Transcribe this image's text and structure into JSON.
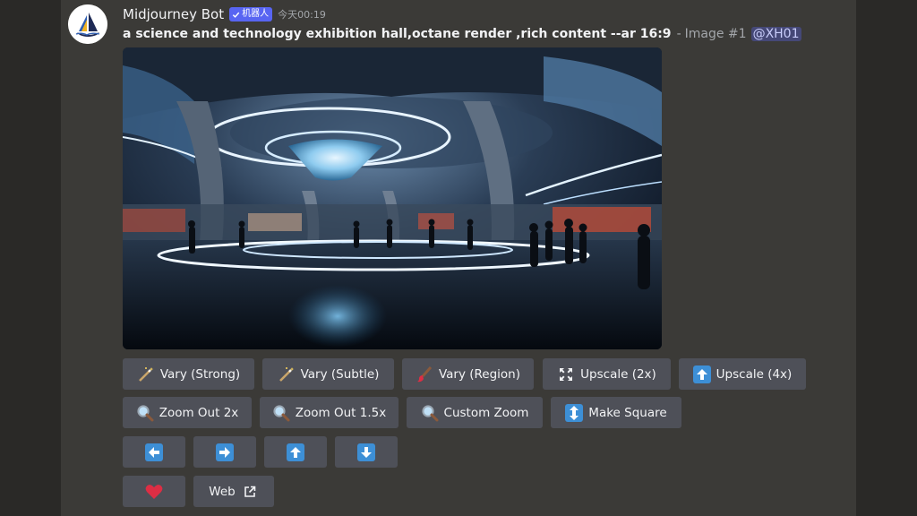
{
  "message": {
    "bot_name": "Midjourney Bot",
    "badge": "机器人",
    "timestamp": "今天00:19",
    "prompt": "a science and technology exhibition hall,octane render ,rich content --ar 16:9",
    "separator": "-",
    "image_label": "Image #1",
    "mention": "@XH01"
  },
  "buttons": {
    "row1": [
      "Vary (Strong)",
      "Vary (Subtle)",
      "Vary (Region)",
      "Upscale (2x)",
      "Upscale (4x)"
    ],
    "row2": [
      "Zoom Out 2x",
      "Zoom Out 1.5x",
      "Custom Zoom",
      "Make Square"
    ],
    "web": "Web"
  },
  "icons": {
    "vary_strong": "magic-wand-icon",
    "vary_subtle": "magic-wand-icon",
    "vary_region": "paintbrush-icon",
    "upscale_2x": "expand-arrows-icon",
    "upscale_4x": "up-arrow-box-icon",
    "zoom": "magnifier-icon",
    "make_square": "up-down-arrow-icon",
    "pan": [
      "left-arrow-icon",
      "right-arrow-icon",
      "up-arrow-icon",
      "down-arrow-icon"
    ],
    "heart": "heart-icon",
    "external": "external-link-icon"
  },
  "colors": {
    "background": "#3b3a37",
    "button": "#4e5058",
    "badge": "#5865f2",
    "arrow_box": "#3d8fd6",
    "heart": "#dd2e44"
  }
}
